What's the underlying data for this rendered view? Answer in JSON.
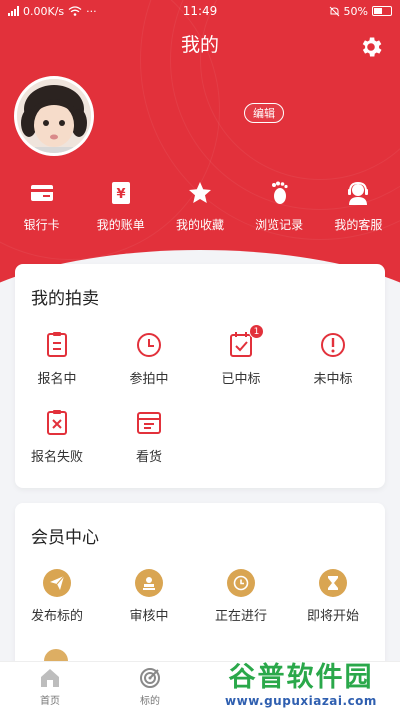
{
  "status_bar": {
    "speed": "0.00K/s",
    "dots": "···",
    "time": "11:49",
    "battery": "50%"
  },
  "header": {
    "title": "我的",
    "edit_label": "编辑"
  },
  "quick_links": [
    {
      "label": "银行卡",
      "icon": "bank-card-icon"
    },
    {
      "label": "我的账单",
      "icon": "bill-icon"
    },
    {
      "label": "我的收藏",
      "icon": "star-icon"
    },
    {
      "label": "浏览记录",
      "icon": "footprint-icon"
    },
    {
      "label": "我的客服",
      "icon": "customer-service-icon"
    }
  ],
  "auction": {
    "title": "我的拍卖",
    "items": [
      {
        "label": "报名中",
        "icon": "register-icon"
      },
      {
        "label": "参拍中",
        "icon": "clock-icon"
      },
      {
        "label": "已中标",
        "icon": "won-check-icon",
        "badge": "1"
      },
      {
        "label": "未中标",
        "icon": "alert-icon"
      },
      {
        "label": "报名失败",
        "icon": "fail-icon"
      },
      {
        "label": "看货",
        "icon": "inspect-goods-icon"
      }
    ]
  },
  "member": {
    "title": "会员中心",
    "items": [
      {
        "label": "发布标的",
        "icon": "send-icon"
      },
      {
        "label": "审核中",
        "icon": "stamp-icon"
      },
      {
        "label": "正在进行",
        "icon": "clock-icon"
      },
      {
        "label": "即将开始",
        "icon": "hourglass-icon"
      }
    ]
  },
  "tabbar": [
    {
      "label": "首页",
      "icon": "home-icon"
    },
    {
      "label": "标的",
      "icon": "target-icon"
    }
  ],
  "watermark": {
    "main": "谷普软件园",
    "url": "www.gupuxiazai.com"
  },
  "colors": {
    "primary": "#e2313b",
    "gold": "#d9a552",
    "background": "#f3f4f7"
  }
}
